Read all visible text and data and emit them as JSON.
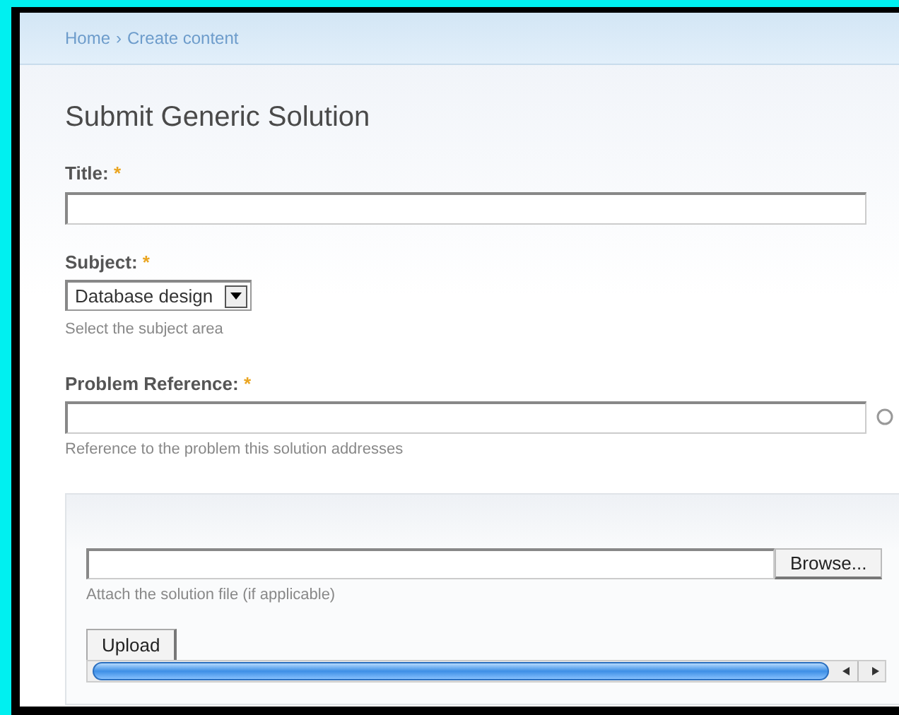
{
  "breadcrumb": {
    "items": [
      {
        "label": "Home"
      },
      {
        "label": "Create content"
      }
    ],
    "separator": "›"
  },
  "page_title": "Submit Generic Solution",
  "fields": [
    {
      "kind": "text",
      "label": "Title:",
      "required_mark": "*"
    },
    {
      "kind": "select",
      "label": "Subject:",
      "required_mark": "*",
      "value": "Database design",
      "help": "Select the subject area"
    },
    {
      "kind": "autocomplete",
      "label": "Problem Reference:",
      "required_mark": "*",
      "help": "Reference to the problem this solution addresses"
    }
  ],
  "attachment": {
    "browse_button": "Browse...",
    "help": "Attach the solution file (if applicable)",
    "upload_button": "Upload"
  }
}
